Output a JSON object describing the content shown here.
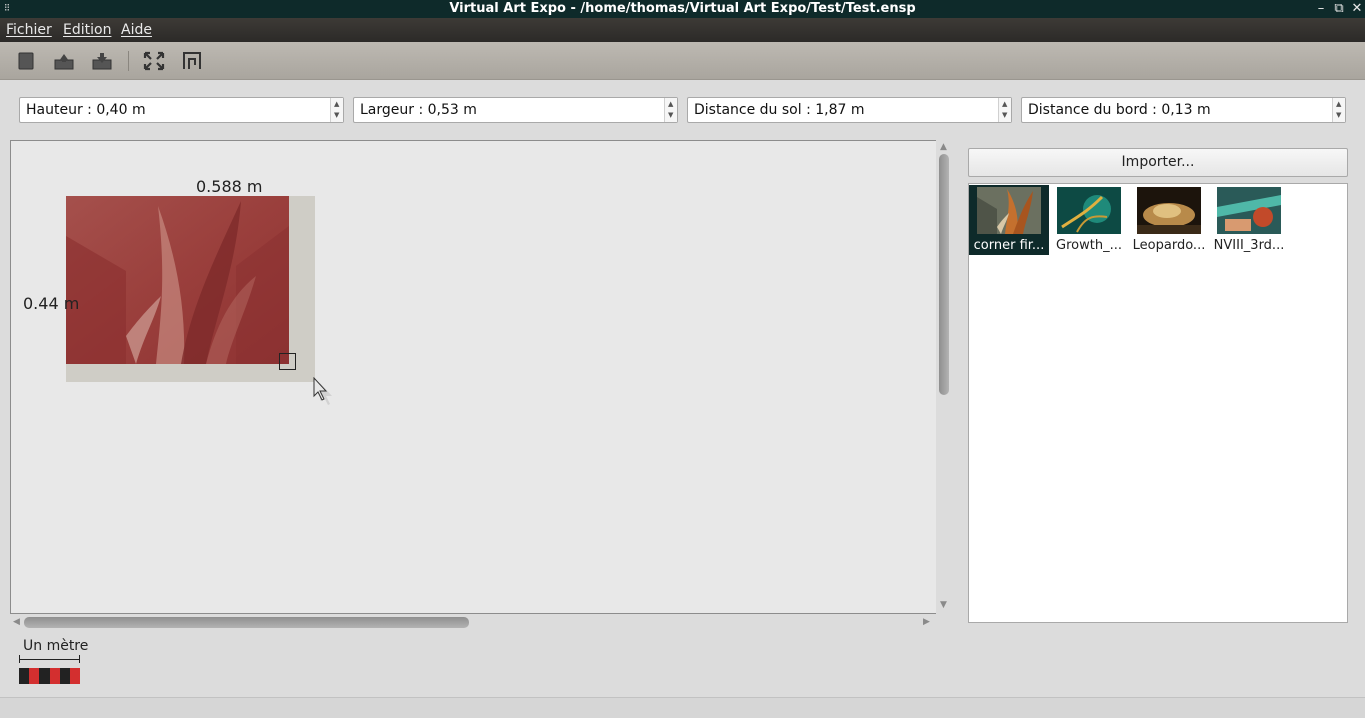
{
  "window": {
    "title": "Virtual Art Expo - /home/thomas/Virtual Art Expo/Test/Test.ensp",
    "controls": [
      "minimize-icon",
      "maximize-icon",
      "close-icon"
    ]
  },
  "menubar": {
    "items": [
      "Fichier",
      "Edition",
      "Aide"
    ]
  },
  "toolbar": {
    "buttons": [
      "new-document-icon",
      "open-icon",
      "save-icon",
      "fullscreen-icon",
      "wall-view-icon"
    ]
  },
  "fields": [
    {
      "label": "Hauteur : 0,40 m"
    },
    {
      "label": "Largeur : 0,53 m"
    },
    {
      "label": "Distance du sol : 1,87 m"
    },
    {
      "label": "Distance du bord : 0,13 m"
    }
  ],
  "canvas": {
    "width_label": "0.588 m",
    "height_label": "0.44 m"
  },
  "panel": {
    "import_label": "Importer...",
    "thumbnails": [
      {
        "caption": "corner fir...",
        "selected": true
      },
      {
        "caption": "Growth_...",
        "selected": false
      },
      {
        "caption": "Leopardo...",
        "selected": false
      },
      {
        "caption": "NVIII_3rd...",
        "selected": false
      }
    ]
  },
  "scale": {
    "label": "Un mètre",
    "colors": [
      "#222222",
      "#d32f2f",
      "#222222",
      "#d32f2f",
      "#222222",
      "#d32f2f"
    ]
  },
  "colors": {
    "titlebar": "#0e2a2a",
    "painting_tint": "#9e3b3b",
    "selection": "#0e2a2a"
  }
}
